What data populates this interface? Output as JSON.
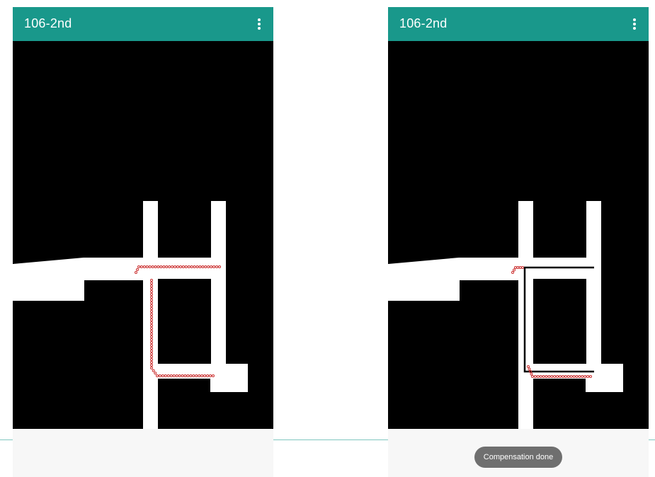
{
  "left_screen": {
    "app_title": "106-2nd",
    "menu_icon": "more-vert-icon"
  },
  "right_screen": {
    "app_title": "106-2nd",
    "menu_icon": "more-vert-icon",
    "toast": "Compensation done"
  },
  "colors": {
    "app_bar": "#19988b",
    "map_background": "#000000",
    "corridor": "#ffffff",
    "trajectory_point": "#cc3333",
    "compensated_path": "#000000",
    "toast_background": "#6f6f6f"
  }
}
